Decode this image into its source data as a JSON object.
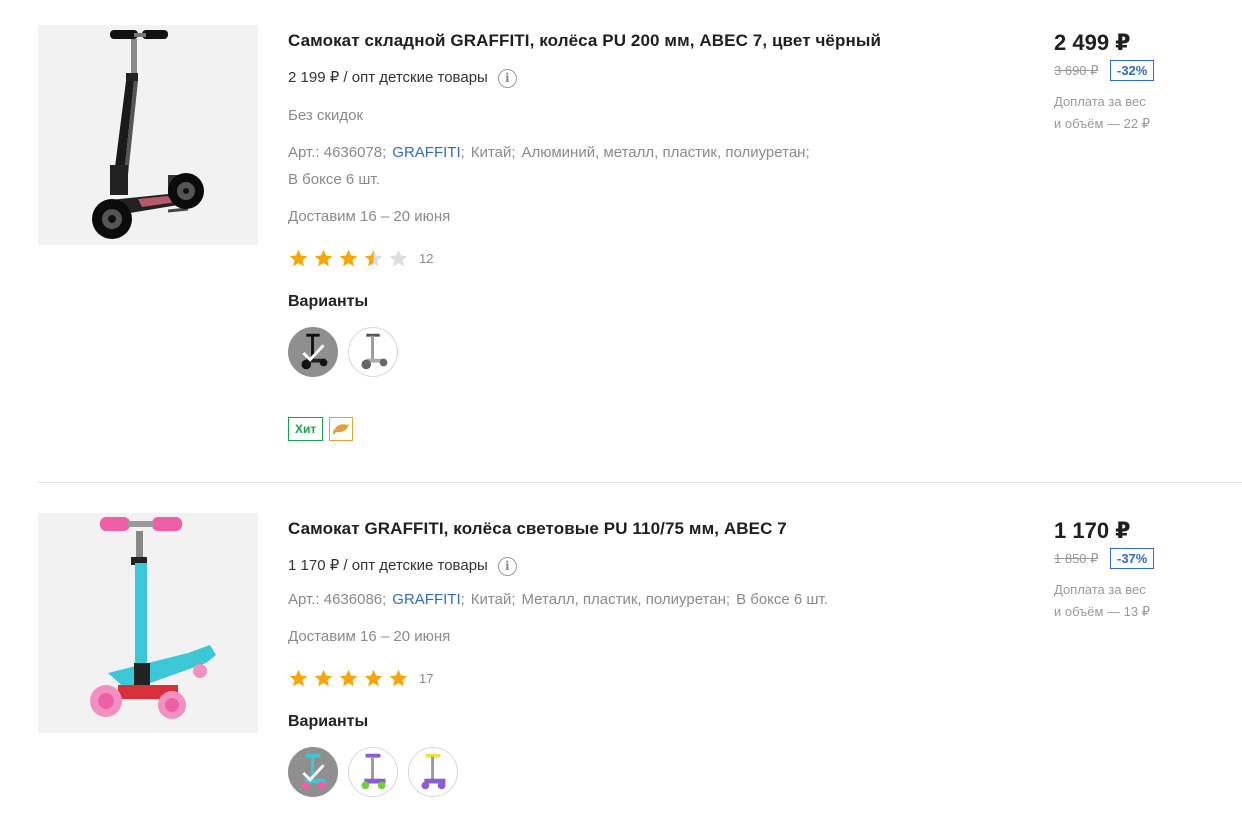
{
  "products": [
    {
      "title": "Самокат складной GRAFFITI, колёса PU 200 мм, ABEC 7, цвет чёрный",
      "unit_price": "2 199 ₽ / опт детские товары",
      "info_glyph": "i",
      "discount_note": "Без скидок",
      "article": "Арт.: 4636078;",
      "brand": "GRAFFITI",
      "brand_sep": ";",
      "country": "Китай;",
      "material": "Алюминий, металл, пластик, полиуретан;",
      "box": "В боксе 6 шт.",
      "delivery": "Доставим 16 – 20 июня",
      "rating": 3.5,
      "rating_count": "12",
      "variants_label": "Варианты",
      "badge_hit": "Хит",
      "price": "2 499 ₽",
      "old_price": "3 690 ₽",
      "discount": "-32%",
      "surcharge_line1": "Доплата за вес",
      "surcharge_line2": "и объём — 22 ₽"
    },
    {
      "title": "Самокат GRAFFITI, колёса световые PU 110/75 мм, ABEC 7",
      "unit_price": "1 170 ₽ / опт детские товары",
      "info_glyph": "i",
      "article": "Арт.: 4636086;",
      "brand": "GRAFFITI",
      "brand_sep": ";",
      "country": "Китай;",
      "material": "Металл, пластик, полиуретан;",
      "box": "В боксе 6 шт.",
      "delivery": "Доставим 16 – 20 июня",
      "rating": 5,
      "rating_count": "17",
      "variants_label": "Варианты",
      "price": "1 170 ₽",
      "old_price": "1 850 ₽",
      "discount": "-37%",
      "surcharge_line1": "Доплата за вес",
      "surcharge_line2": "и объём — 13 ₽"
    }
  ],
  "colors": {
    "star_filled": "#f5a70a",
    "star_empty": "#dddddd",
    "brand_link": "#2f6bc4",
    "badge_hit": "#1aa34a",
    "badge_dolphin": "#e0a23a"
  },
  "icons": {
    "info": "info-circle-icon",
    "star": "star-icon",
    "selected": "checkmark-icon",
    "dolphin": "dolphin-icon"
  }
}
